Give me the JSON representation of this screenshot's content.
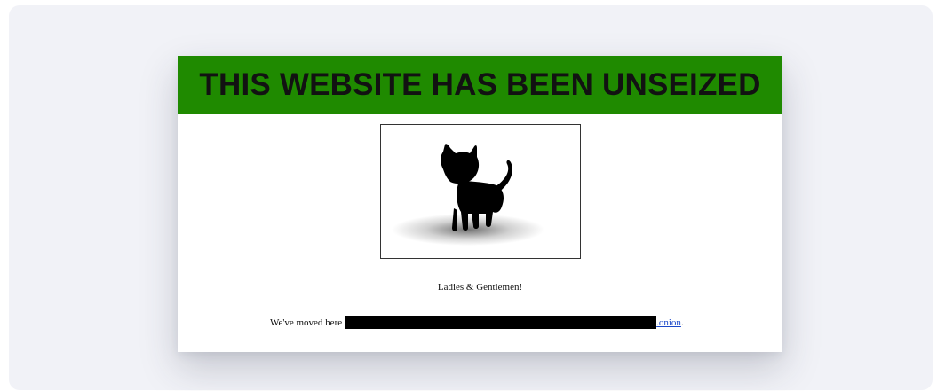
{
  "banner": {
    "title": "THIS WEBSITE HAS BEEN UNSEIZED",
    "background_color": "#1f8a00",
    "text_color": "#121212"
  },
  "image": {
    "icon": "black-cat-silhouette"
  },
  "content": {
    "greeting": "Ladies & Gentlemen!",
    "moved_prefix": "We've moved here",
    "link_text": ".onion",
    "trailing": "."
  },
  "colors": {
    "panel_background": "#f1f2f7",
    "link": "#1a47c9"
  }
}
